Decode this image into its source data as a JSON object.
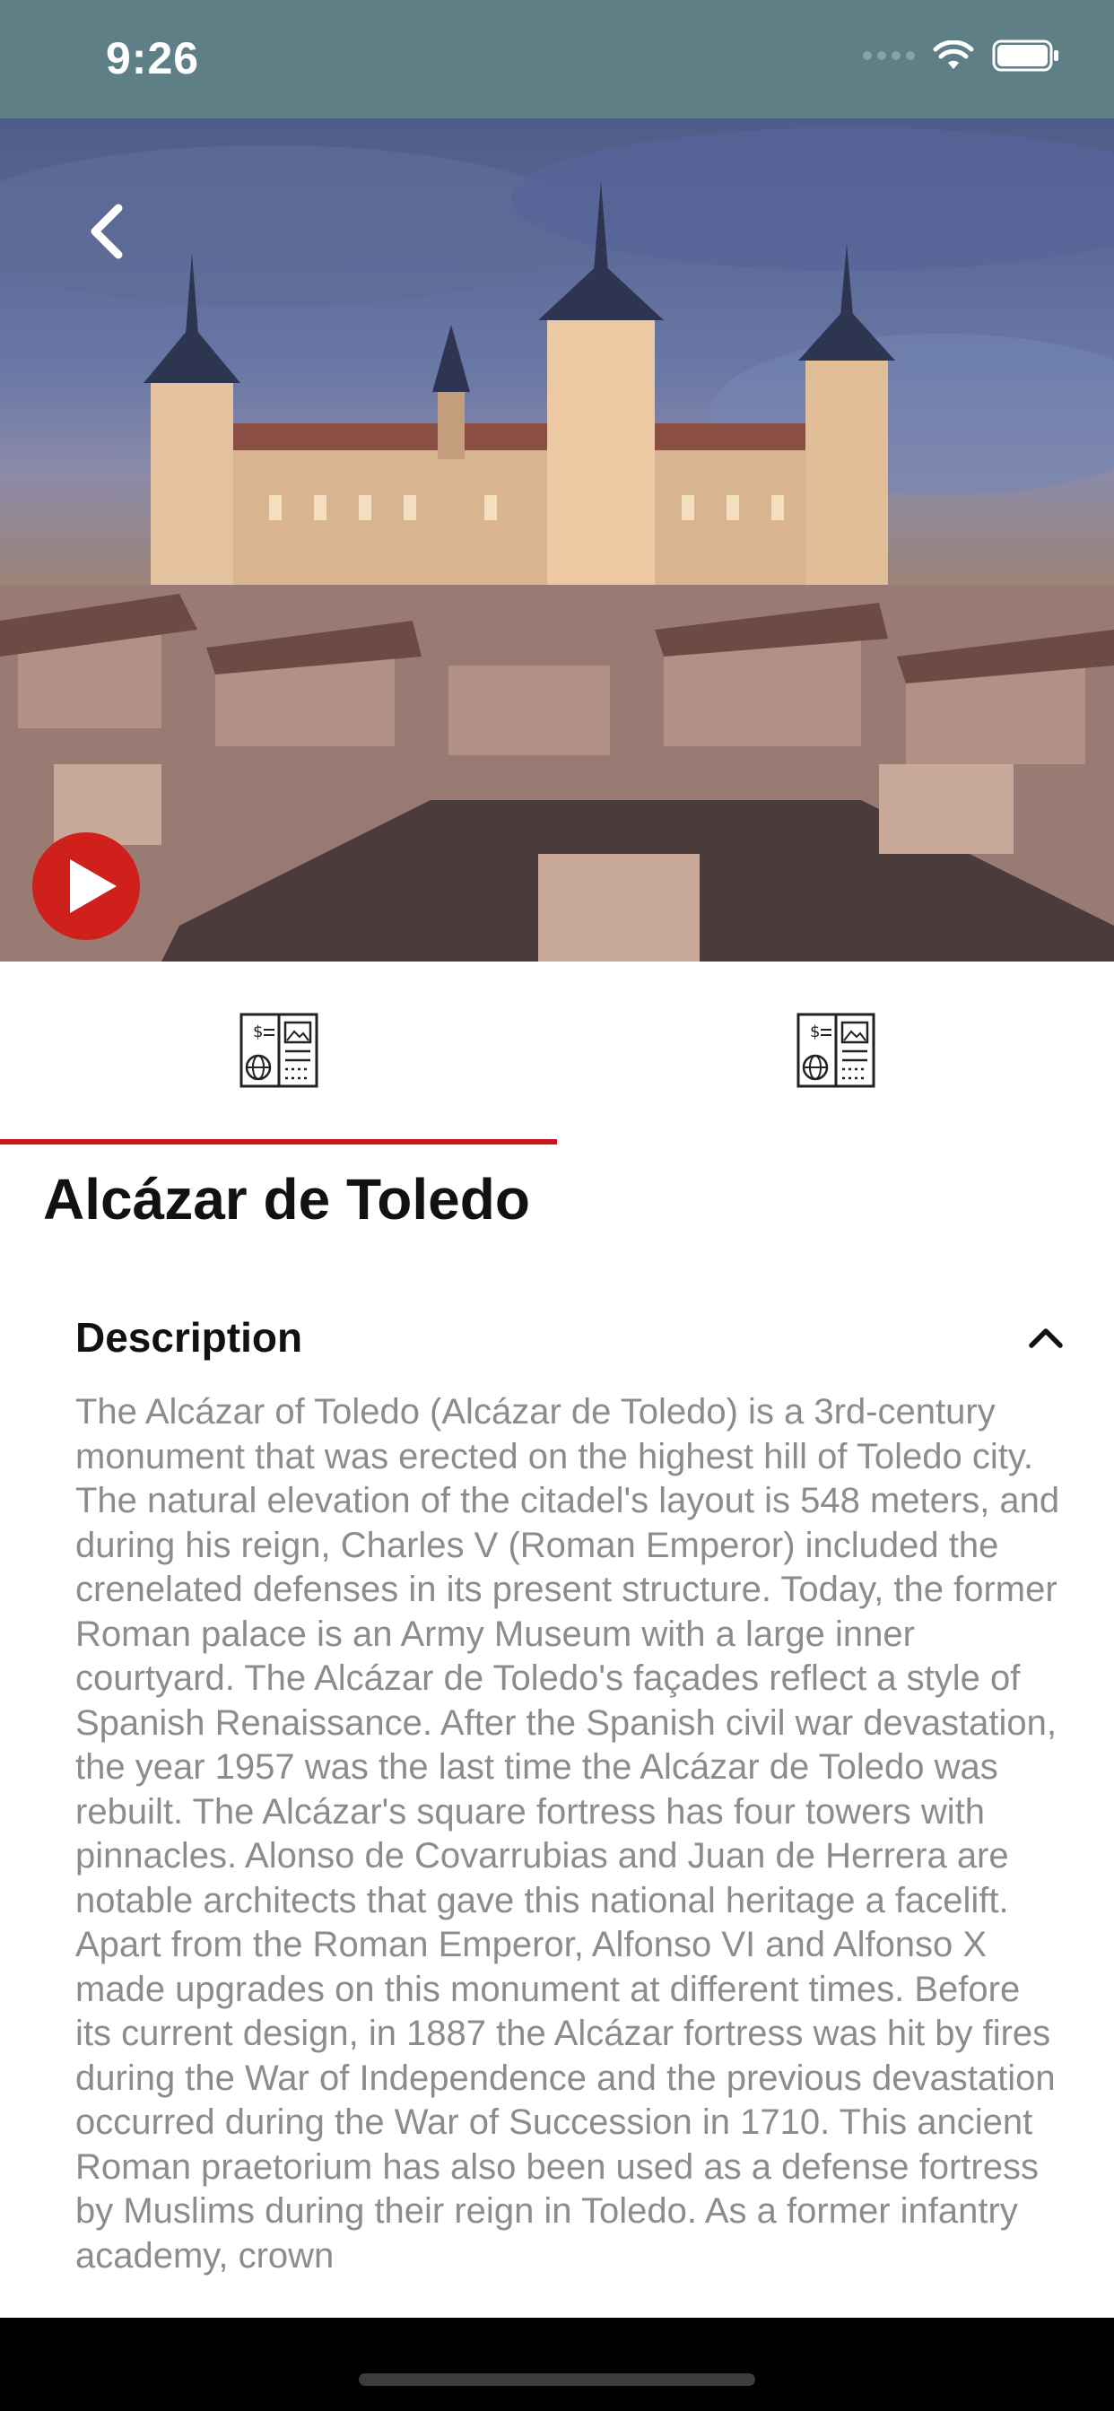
{
  "status_bar": {
    "time": "9:26"
  },
  "hero": {
    "image_alt": "Alcázar de Toledo photo",
    "back_icon": "chevron-left-icon",
    "play_icon": "play-icon"
  },
  "tabs": [
    {
      "icon": "brochure-icon",
      "selected": true
    },
    {
      "icon": "brochure-icon",
      "selected": false
    }
  ],
  "page": {
    "title": "Alcázar de Toledo",
    "section_title": "Description",
    "section_toggle_icon": "chevron-up-icon",
    "paragraphs": [
      "The Alcázar of Toledo (Alcázar de Toledo) is a 3rd-century monument that was erected on the highest hill of Toledo city. The natural elevation of the citadel's layout is 548 meters, and during his reign, Charles V (Roman Emperor) included the crenelated defenses in its present structure. Today, the former Roman palace is an Army Museum with a large inner courtyard. The Alcázar de Toledo's façades reflect a style of Spanish Renaissance. After the Spanish civil war devastation, the year 1957 was the last time the Alcázar de Toledo was rebuilt. The Alcázar's square fortress has four towers with pinnacles. Alonso de Covarrubias and Juan de Herrera are notable architects that gave this national heritage a facelift.",
      "Apart from the Roman Emperor, Alfonso VI and Alfonso X made upgrades on this monument at different times. Before its current design, in 1887 the Alcázar fortress was hit by fires during the War of Independence and the previous devastation occurred during the War of Succession in 1710. This ancient Roman praetorium has also been used as a defense fortress by Muslims during their reign in Toledo. As a former infantry academy, crown"
    ]
  },
  "colors": {
    "status_bar": "#5f7f86",
    "accent": "#c9151b",
    "play_button": "#d0201c",
    "body_text": "#8c8c8c"
  }
}
